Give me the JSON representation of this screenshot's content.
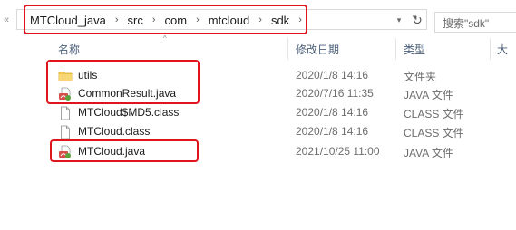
{
  "address_bar": {
    "back_glyph": "«",
    "crumbs": [
      "MTCloud_java",
      "src",
      "com",
      "mtcloud",
      "sdk"
    ],
    "separator": "›",
    "dropdown_glyph": "▾",
    "refresh_glyph": "↻"
  },
  "search": {
    "placeholder": "搜索\"sdk\""
  },
  "columns": {
    "name": "名称",
    "modified": "修改日期",
    "type": "类型",
    "size": "大",
    "sort_caret": "^"
  },
  "files": [
    {
      "name": "utils",
      "modified": "2020/1/8 14:16",
      "type": "文件夹",
      "icon": "folder-icon"
    },
    {
      "name": "CommonResult.java",
      "modified": "2020/7/16 11:35",
      "type": "JAVA 文件",
      "icon": "java-file-icon"
    },
    {
      "name": "MTCloud$MD5.class",
      "modified": "2020/1/8 14:16",
      "type": "CLASS 文件",
      "icon": "class-file-icon"
    },
    {
      "name": "MTCloud.class",
      "modified": "2020/1/8 14:16",
      "type": "CLASS 文件",
      "icon": "class-file-icon"
    },
    {
      "name": "MTCloud.java",
      "modified": "2021/10/25 11:00",
      "type": "JAVA 文件",
      "icon": "java-file-icon"
    }
  ],
  "colors": {
    "highlight": "#e0141c",
    "folder": "#f2c94c",
    "header_text": "#4c607a"
  }
}
